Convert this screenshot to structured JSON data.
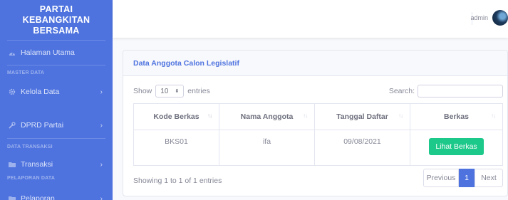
{
  "sidebar": {
    "brand_line1": "PARTAI",
    "brand_line2": "KEBANGKITAN",
    "brand_line3": "BERSAMA",
    "dashboard_label": "Halaman Utama",
    "heading_master": "MASTER DATA",
    "kelola_label": "Kelola Data",
    "dprd_label": "DPRD Partai",
    "heading_transaksi": "DATA TRANSAKSI",
    "transaksi_label": "Transaksi",
    "heading_laporan": "PELAPORAN DATA",
    "pelaporan_label": "Pelaporan"
  },
  "topbar": {
    "user_name": "admin"
  },
  "card": {
    "title": "Data Anggota Calon Legislatif",
    "show_label": "Show",
    "entries_value": "10",
    "entries_label": "entries",
    "search_label": "Search:",
    "search_value": ""
  },
  "table": {
    "columns": [
      "Kode Berkas",
      "Nama Anggota",
      "Tanggal Daftar",
      "Berkas"
    ],
    "rows": [
      {
        "kode": "BKS01",
        "nama": "ifa",
        "tanggal": "09/08/2021",
        "berkas_button": "Lihat Berkas"
      }
    ]
  },
  "footer": {
    "info": "Showing 1 to 1 of 1 entries",
    "previous": "Previous",
    "page": "1",
    "next": "Next"
  },
  "colors": {
    "sidebar": "#4e73df",
    "primary": "#4e73df",
    "success": "#1cc88a",
    "text_muted": "#858796"
  },
  "icons": [
    "tachometer-icon",
    "cog-icon",
    "wrench-icon",
    "folder-icon",
    "chevron-right-icon",
    "sort-icon"
  ]
}
